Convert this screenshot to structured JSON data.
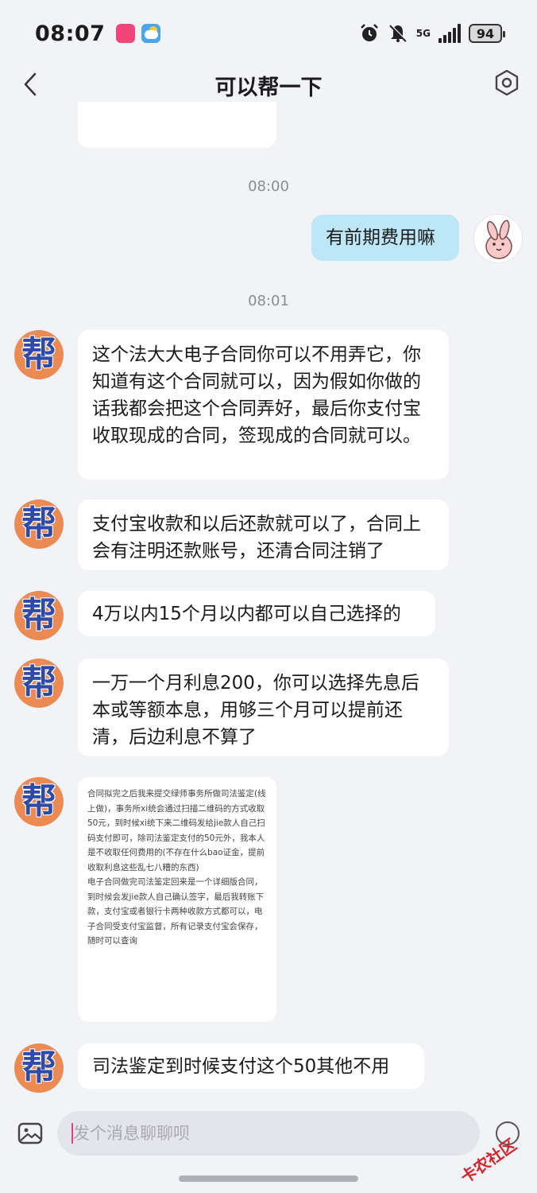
{
  "status_bar": {
    "time": "08:07",
    "network": "5G",
    "battery": "94"
  },
  "header": {
    "title": "可以帮一下"
  },
  "messages": {
    "ts1": "08:00",
    "out1": "有前期费用嘛",
    "ts2": "08:01",
    "in1": "这个法大大电子合同你可以不用弄它，你知道有这个合同就可以，因为假如你做的话我都会把这个合同弄好，最后你支付宝收取现成的合同，签现成的合同就可以。",
    "in2": "支付宝收款和以后还款就可以了，合同上会有注明还款账号，还清合同注销了",
    "in3": "4万以内15个月以内都可以自己选择的",
    "in4": "一万一个月利息200，你可以选择先息后本或等额本息，用够三个月可以提前还清，后边利息不算了",
    "image_text_1": "合同拟完之后我来提交绿师事务所做司法鉴定(线上做)，事务所xi统会通过扫描二维码的方式收取50元，到时候xi统下来二维码发给jie款人自己扫码支付即可，除司法鉴定支付的50元外，我本人是不收取任何费用的(不存在什么bao证金，提前收取利息这些乱七八糟的东西)",
    "image_text_2": "电子合同做完司法鉴定回来是一个详细版合同，到时候会发jie款人自己确认签字，最后我转账下款，支付宝或者银行卡两种收款方式都可以，电子合同受支付宝监督，所有记录支付宝会保存，随时可以查询",
    "in5": "司法鉴定到时候支付这个50其他不用"
  },
  "contact": {
    "avatar_char": "帮"
  },
  "input": {
    "placeholder": "发个消息聊聊呗"
  },
  "watermark": {
    "text": "卡农社区"
  }
}
